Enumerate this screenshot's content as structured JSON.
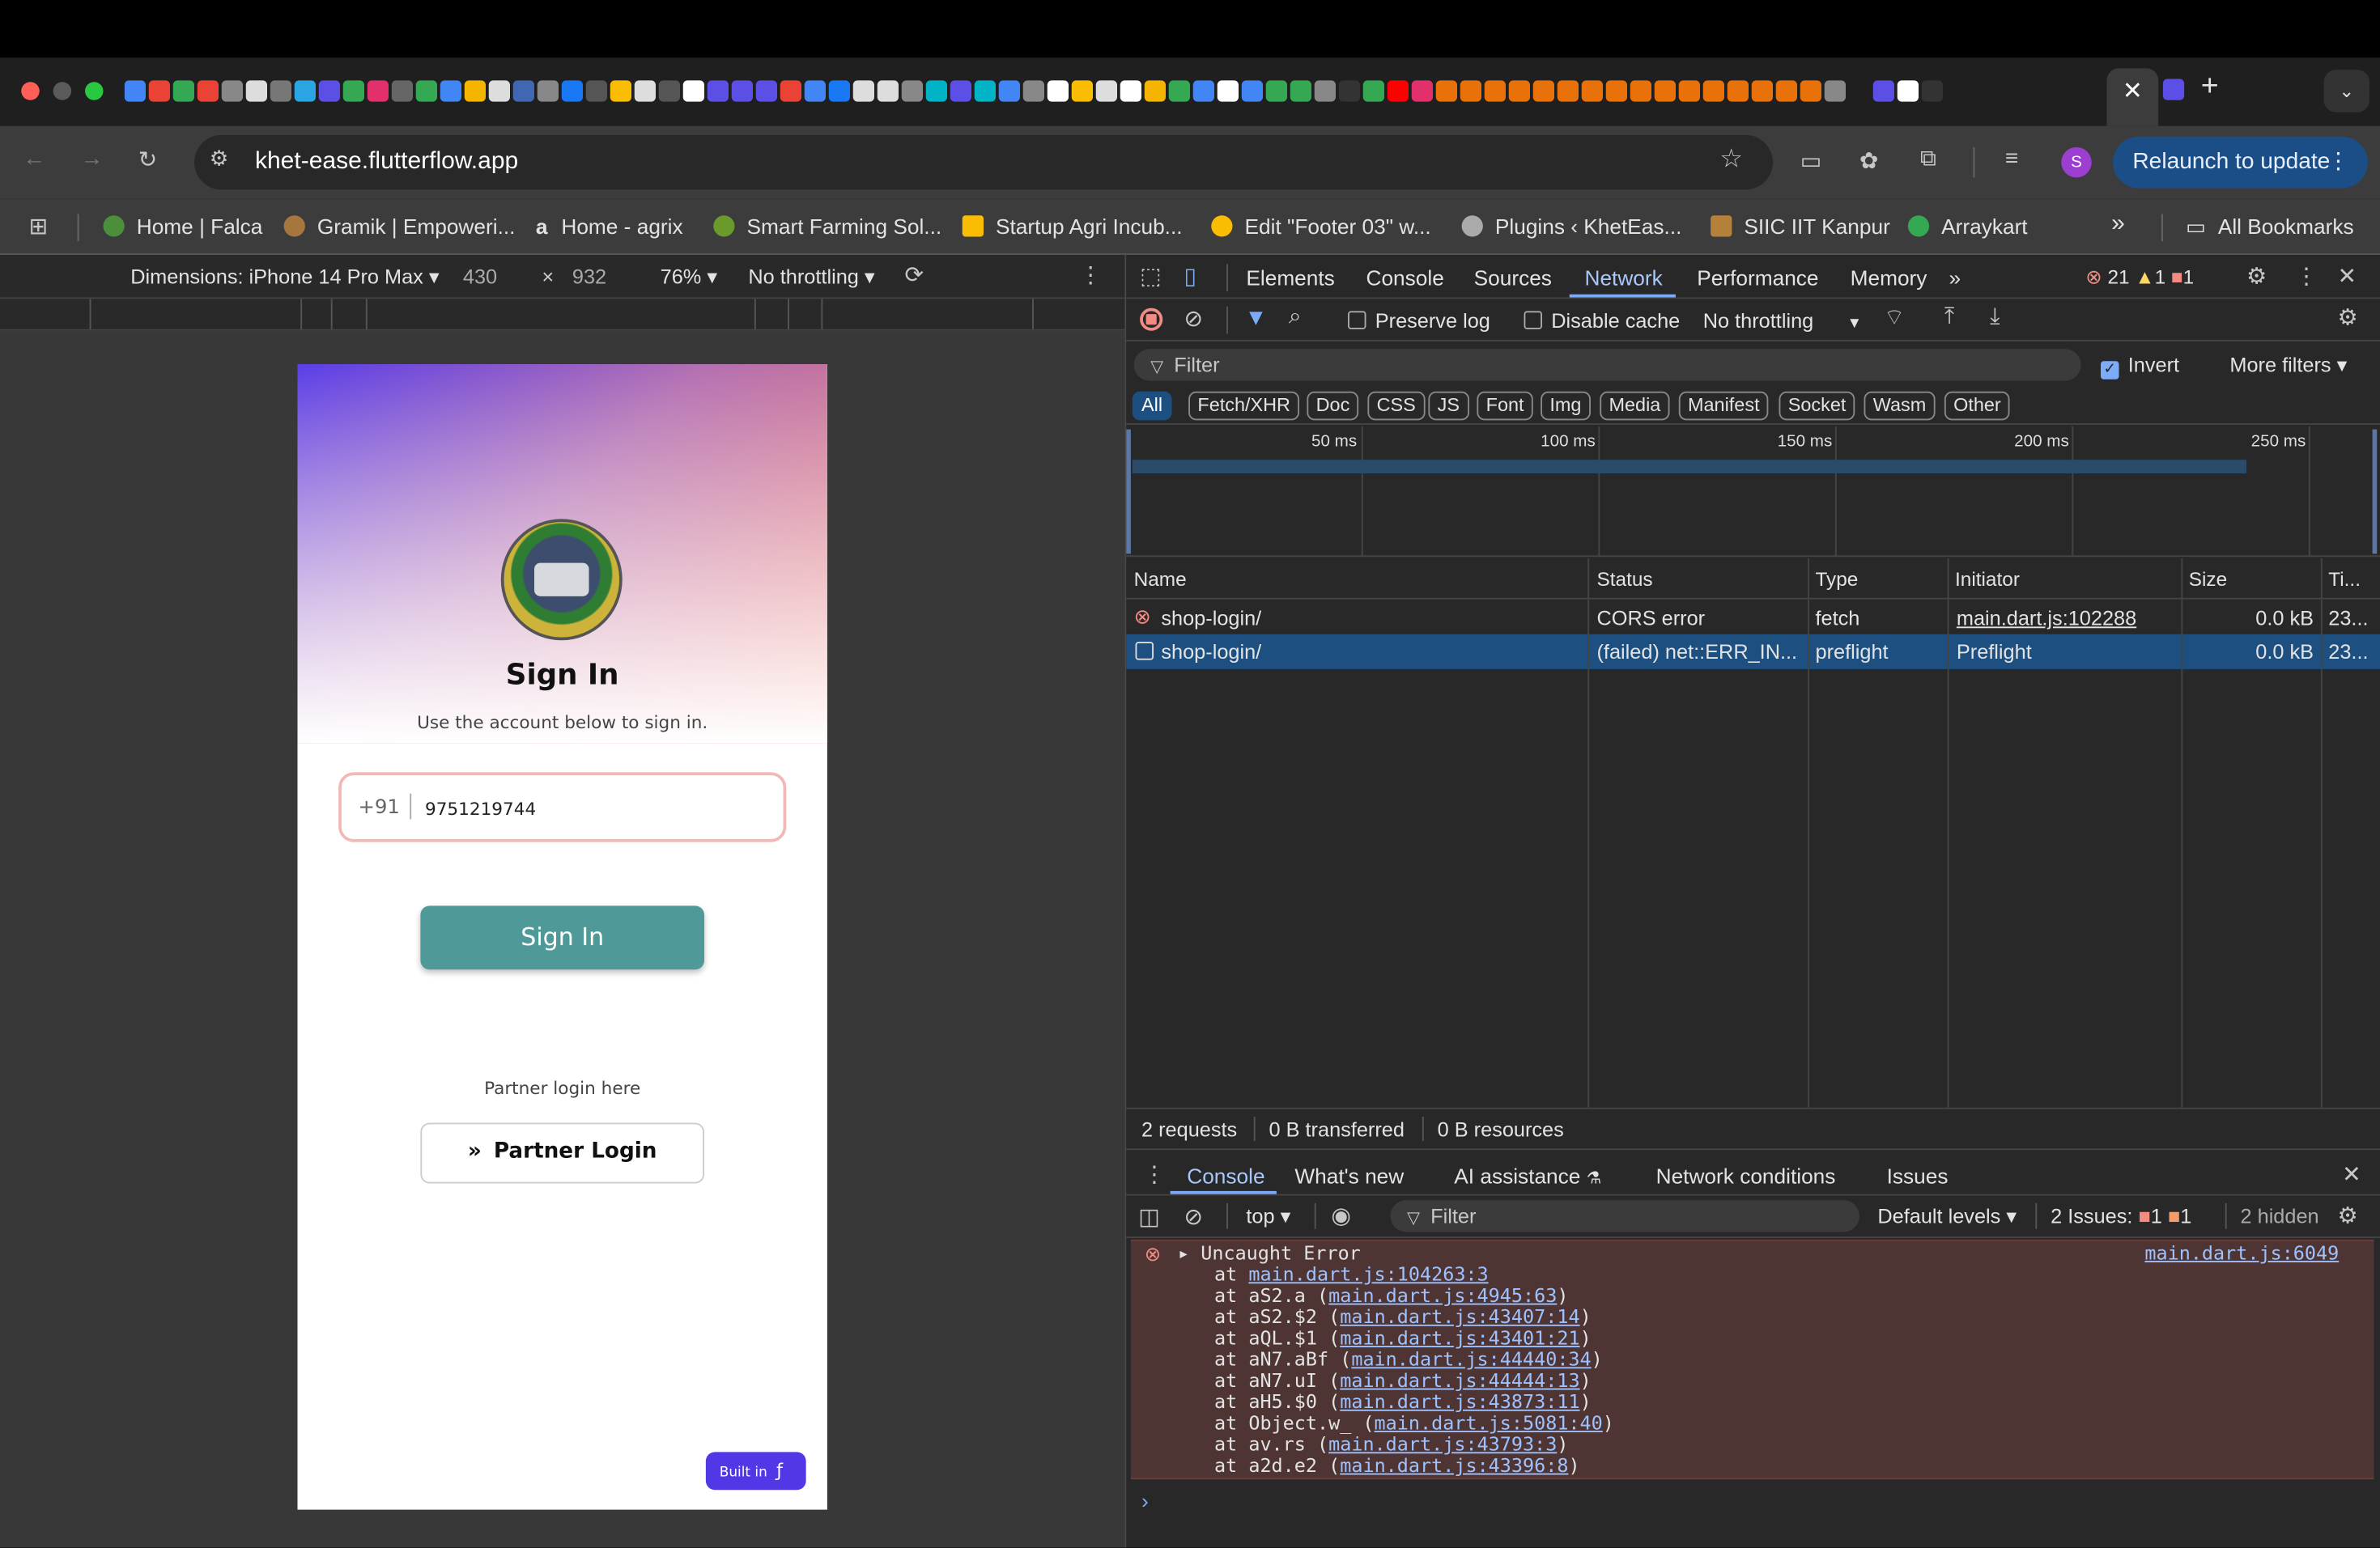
{
  "browser": {
    "url": "khet-ease.flutterflow.app",
    "relaunch_label": "Relaunch to update",
    "active_tab_close": "✕",
    "new_tab": "+",
    "profile_initial": "S"
  },
  "bookmarks": {
    "items": [
      "Home | Falca",
      "Gramik | Empoweri...",
      "Home - agrix",
      "Smart Farming Sol...",
      "Startup Agri Incub...",
      "Edit \"Footer 03\" w...",
      "Plugins ‹ KhetEas...",
      "SIIC IIT Kanpur",
      "Arraykart"
    ],
    "overflow": "»",
    "all_bookmarks": "All Bookmarks"
  },
  "emulation": {
    "device": "Dimensions: iPhone 14 Pro Max",
    "width": "430",
    "times": "×",
    "height": "932",
    "zoom": "76%",
    "throttling": "No throttling"
  },
  "app": {
    "title": "Sign In",
    "subtitle": "Use the account below to sign in.",
    "country_code": "+91",
    "phone": "9751219744",
    "signin_button": "Sign In",
    "partner_hint": "Partner login here",
    "partner_button": "Partner Login",
    "built_in": "Built in"
  },
  "devtools": {
    "tabs": [
      "Elements",
      "Console",
      "Sources",
      "Network",
      "Performance",
      "Memory"
    ],
    "active_tab": "Network",
    "errors": "21",
    "warnings": "1",
    "issues": "1",
    "preserve_log": "Preserve log",
    "disable_cache": "Disable cache",
    "throttling": "No throttling",
    "filter_placeholder": "Filter",
    "invert": "Invert",
    "more_filters": "More filters",
    "type_filters": [
      "All",
      "Fetch/XHR",
      "Doc",
      "CSS",
      "JS",
      "Font",
      "Img",
      "Media",
      "Manifest",
      "Socket",
      "Wasm",
      "Other"
    ],
    "timeline_labels": [
      "50 ms",
      "100 ms",
      "150 ms",
      "200 ms",
      "250 ms"
    ],
    "columns": [
      "Name",
      "Status",
      "Type",
      "Initiator",
      "Size",
      "Ti..."
    ],
    "requests": [
      {
        "name": "shop-login/",
        "status": "CORS error",
        "type": "fetch",
        "initiator": "main.dart.js:102288",
        "size": "0.0 kB",
        "time": "23..."
      },
      {
        "name": "shop-login/",
        "status": "(failed) net::ERR_IN...",
        "type": "preflight",
        "initiator": "Preflight",
        "size": "0.0 kB",
        "time": "23..."
      }
    ],
    "summary": [
      "2 requests",
      "0 B transferred",
      "0 B resources"
    ],
    "drawer_tabs": [
      "Console",
      "What's new",
      "AI assistance",
      "Network conditions",
      "Issues"
    ],
    "console": {
      "context": "top",
      "filter_placeholder": "Filter",
      "levels": "Default levels",
      "issues_label": "2 Issues:",
      "issues_err": "1",
      "issues_warn": "1",
      "hidden": "2 hidden",
      "error_title": "Uncaught Error",
      "error_source": "main.dart.js:6049",
      "stack": [
        {
          "fn": "",
          "loc": "main.dart.js:104263:3"
        },
        {
          "fn": "aS2.a",
          "loc": "main.dart.js:4945:63"
        },
        {
          "fn": "aS2.$2",
          "loc": "main.dart.js:43407:14"
        },
        {
          "fn": "aQL.$1",
          "loc": "main.dart.js:43401:21"
        },
        {
          "fn": "aN7.aBf",
          "loc": "main.dart.js:44440:34"
        },
        {
          "fn": "aN7.uI",
          "loc": "main.dart.js:44444:13"
        },
        {
          "fn": "aH5.$0",
          "loc": "main.dart.js:43873:11"
        },
        {
          "fn": "Object.w_",
          "loc": "main.dart.js:5081:40"
        },
        {
          "fn": "av.rs",
          "loc": "main.dart.js:43793:3"
        },
        {
          "fn": "a2d.e2",
          "loc": "main.dart.js:43396:8"
        }
      ]
    }
  },
  "colors": {
    "accent": "#7cacf8",
    "signin": "#4f9a98",
    "error_bg": "#4e3534",
    "selected_row": "#1d4f80"
  }
}
